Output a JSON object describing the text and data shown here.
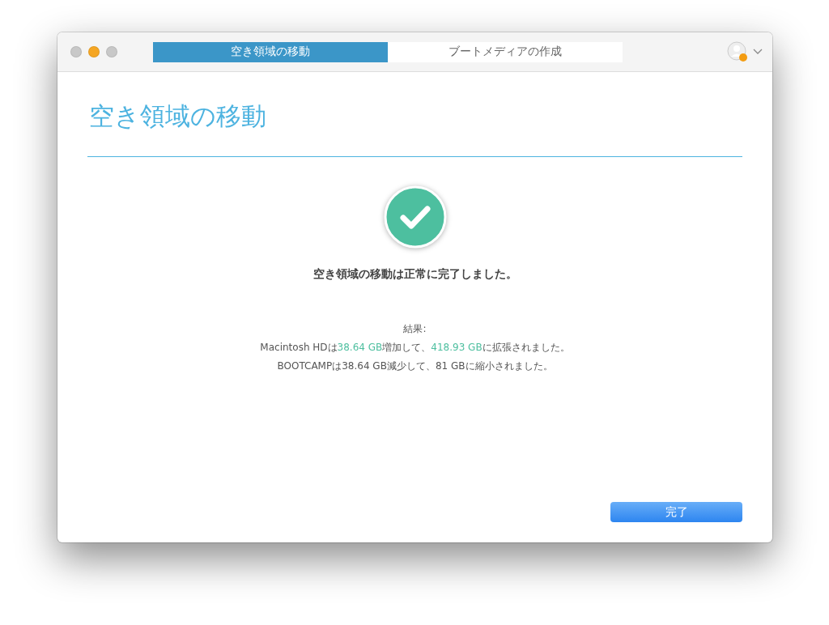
{
  "window": {
    "traffic_lights": [
      {
        "color": "#c8c8c8"
      },
      {
        "color": "#f5a623"
      },
      {
        "color": "#c8c8c8"
      }
    ]
  },
  "tabs": [
    {
      "label": "空き領域の移動",
      "selected": true
    },
    {
      "label": "ブートメディアの作成",
      "selected": false
    }
  ],
  "page_title": "空き領域の移動",
  "status": {
    "kind": "success",
    "message": "空き領域の移動は正常に完了しました。"
  },
  "result": {
    "heading": "結果:",
    "lines": [
      [
        {
          "text": "Macintosh HDは",
          "highlight": false
        },
        {
          "text": "38.64 GB",
          "highlight": true
        },
        {
          "text": "増加して、",
          "highlight": false
        },
        {
          "text": "418.93 GB",
          "highlight": true
        },
        {
          "text": "に拡張されました。",
          "highlight": false
        }
      ],
      [
        {
          "text": "BOOTCAMPは38.64 GB減少して、81 GBに縮小されました。",
          "highlight": false
        }
      ]
    ]
  },
  "buttons": [
    {
      "label": "完了"
    }
  ]
}
